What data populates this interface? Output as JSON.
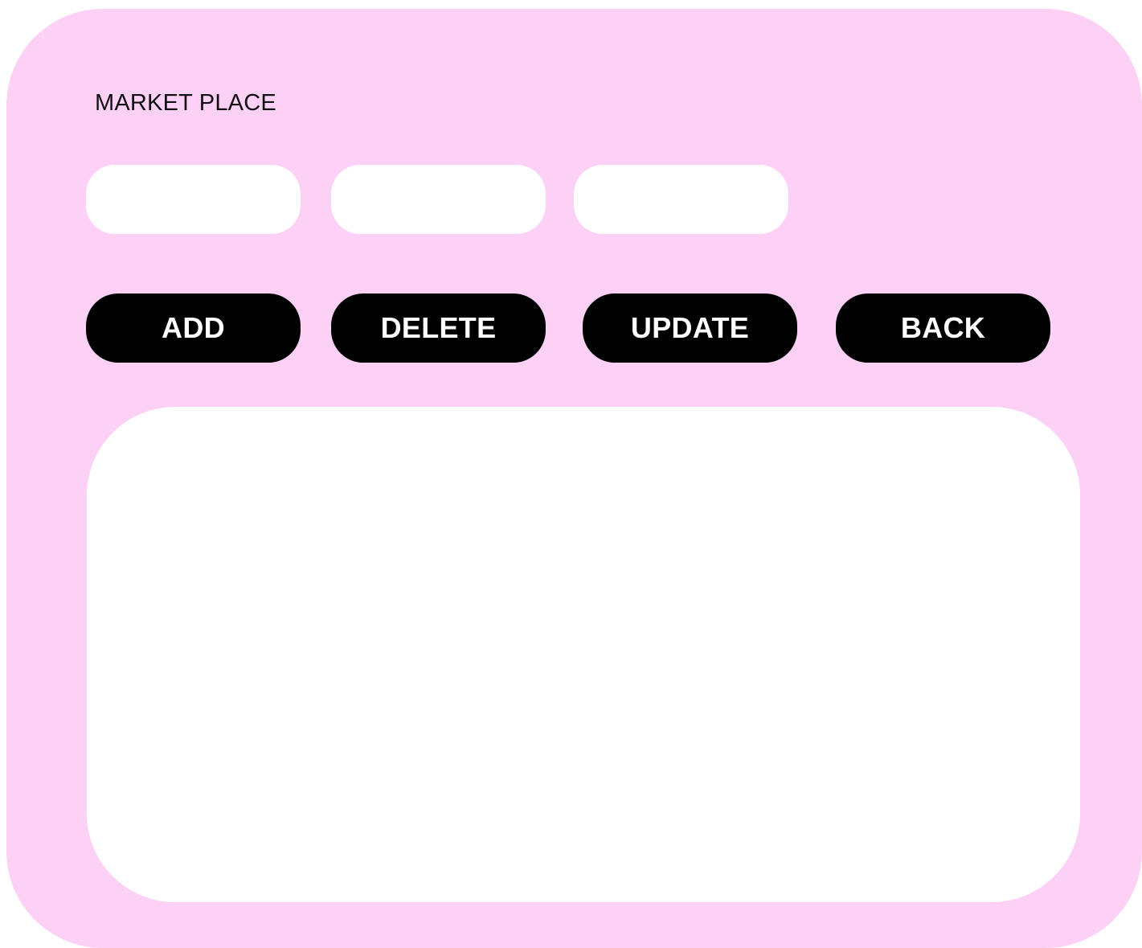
{
  "app": {
    "title": "MARKET PLACE"
  },
  "fields": [
    {
      "value": "",
      "placeholder": ""
    },
    {
      "value": "",
      "placeholder": ""
    },
    {
      "value": "",
      "placeholder": ""
    }
  ],
  "buttons": {
    "add": "ADD",
    "delete": "DELETE",
    "update": "UPDATE",
    "back": "BACK"
  },
  "colors": {
    "background": "#fdd1f6",
    "button": "#000000",
    "button_text": "#ffffff",
    "panel": "#ffffff"
  }
}
